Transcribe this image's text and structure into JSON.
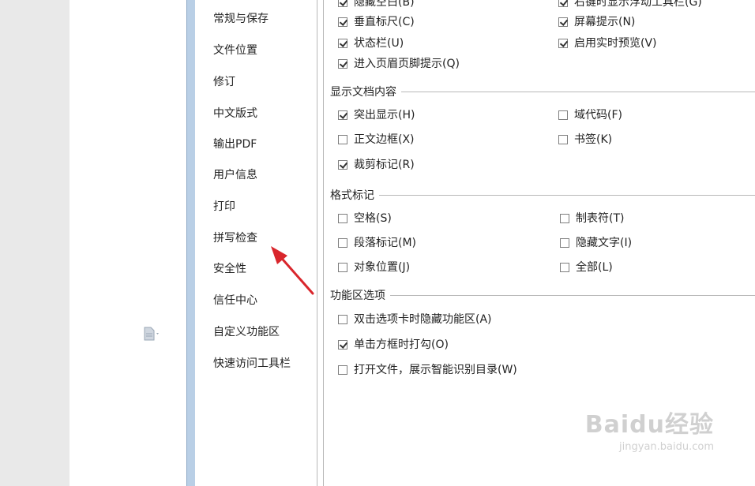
{
  "nav": {
    "items": [
      {
        "label": "常规与保存"
      },
      {
        "label": "文件位置"
      },
      {
        "label": "修订"
      },
      {
        "label": "中文版式"
      },
      {
        "label": "输出PDF"
      },
      {
        "label": "用户信息"
      },
      {
        "label": "打印"
      },
      {
        "label": "拼写检查"
      },
      {
        "label": "安全性"
      },
      {
        "label": "信任中心"
      },
      {
        "label": "自定义功能区"
      },
      {
        "label": "快速访问工具栏"
      }
    ]
  },
  "view_top": {
    "left": [
      {
        "label": "隐藏空白(B)",
        "checked": true
      },
      {
        "label": "垂直标尺(C)",
        "checked": true
      },
      {
        "label": "状态栏(U)",
        "checked": true
      },
      {
        "label": "进入页眉页脚提示(Q)",
        "checked": true
      }
    ],
    "right": [
      {
        "label": "右键时显示浮动工具栏(G)",
        "checked": true
      },
      {
        "label": "屏幕提示(N)",
        "checked": true
      },
      {
        "label": "启用实时预览(V)",
        "checked": true
      }
    ]
  },
  "show_content": {
    "title": "显示文档内容",
    "left": [
      {
        "label": "突出显示(H)",
        "checked": true
      },
      {
        "label": "正文边框(X)",
        "checked": false
      },
      {
        "label": "裁剪标记(R)",
        "checked": true
      }
    ],
    "right": [
      {
        "label": "域代码(F)",
        "checked": false
      },
      {
        "label": "书签(K)",
        "checked": false
      }
    ]
  },
  "format_marks": {
    "title": "格式标记",
    "left": [
      {
        "label": "空格(S)",
        "checked": false
      },
      {
        "label": "段落标记(M)",
        "checked": false
      },
      {
        "label": "对象位置(J)",
        "checked": false
      }
    ],
    "right": [
      {
        "label": "制表符(T)",
        "checked": false
      },
      {
        "label": "隐藏文字(I)",
        "checked": false
      },
      {
        "label": "全部(L)",
        "checked": false
      }
    ]
  },
  "ribbon": {
    "title": "功能区选项",
    "items": [
      {
        "label": "双击选项卡时隐藏功能区(A)",
        "checked": false
      },
      {
        "label": "单击方框时打勾(O)",
        "checked": true
      },
      {
        "label": "打开文件，展示智能识别目录(W)",
        "checked": false
      }
    ]
  },
  "watermark": {
    "logo": "Baidu经验",
    "url": "jingyan.baidu.com"
  },
  "colors": {
    "arrow": "#d9262c"
  }
}
